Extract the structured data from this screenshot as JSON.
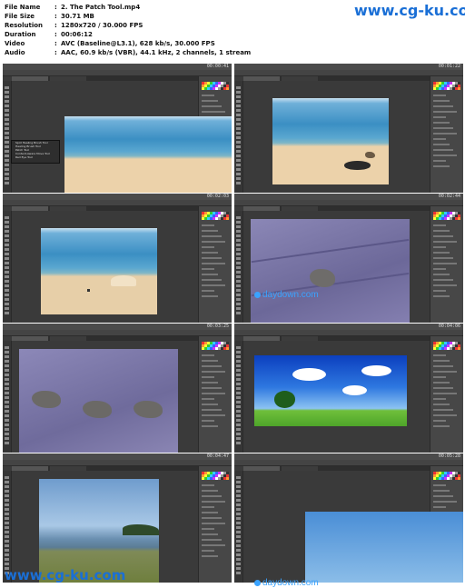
{
  "info": {
    "rows": [
      {
        "key": "File Name",
        "value": "2. The Patch Tool.mp4"
      },
      {
        "key": "File Size",
        "value": "30.71 MB"
      },
      {
        "key": "Resolution",
        "value": "1280x720 / 30.000 FPS"
      },
      {
        "key": "Duration",
        "value": "00:06:12"
      },
      {
        "key": "Video",
        "value": "AVC (Baseline@L3.1), 628 kb/s, 30.000 FPS"
      },
      {
        "key": "Audio",
        "value": "AAC, 60.9 kb/s (VBR), 44.1 kHz, 2 channels, 1 stream"
      }
    ]
  },
  "watermarks": {
    "top": "www.cg-ku.com",
    "bottom": "www.cg-ku.com",
    "daydown": "daydown.com"
  },
  "thumbnails": [
    {
      "timestamp": "00:00:41",
      "scene": "beach-with-flyout"
    },
    {
      "timestamp": "00:01:22",
      "scene": "beach-rock-bird"
    },
    {
      "timestamp": "00:02:03",
      "scene": "beach-plain"
    },
    {
      "timestamp": "00:02:44",
      "scene": "bird-on-deck"
    },
    {
      "timestamp": "00:03:25",
      "scene": "three-birds"
    },
    {
      "timestamp": "00:04:06",
      "scene": "tree-field"
    },
    {
      "timestamp": "00:04:47",
      "scene": "lake-shore"
    },
    {
      "timestamp": "00:05:28",
      "scene": "sky-fullscreen"
    }
  ],
  "flyout_items": [
    "Spot Healing Brush Tool",
    "Healing Brush Tool",
    "Patch Tool",
    "Content-Aware Move Tool",
    "Red Eye Tool"
  ]
}
